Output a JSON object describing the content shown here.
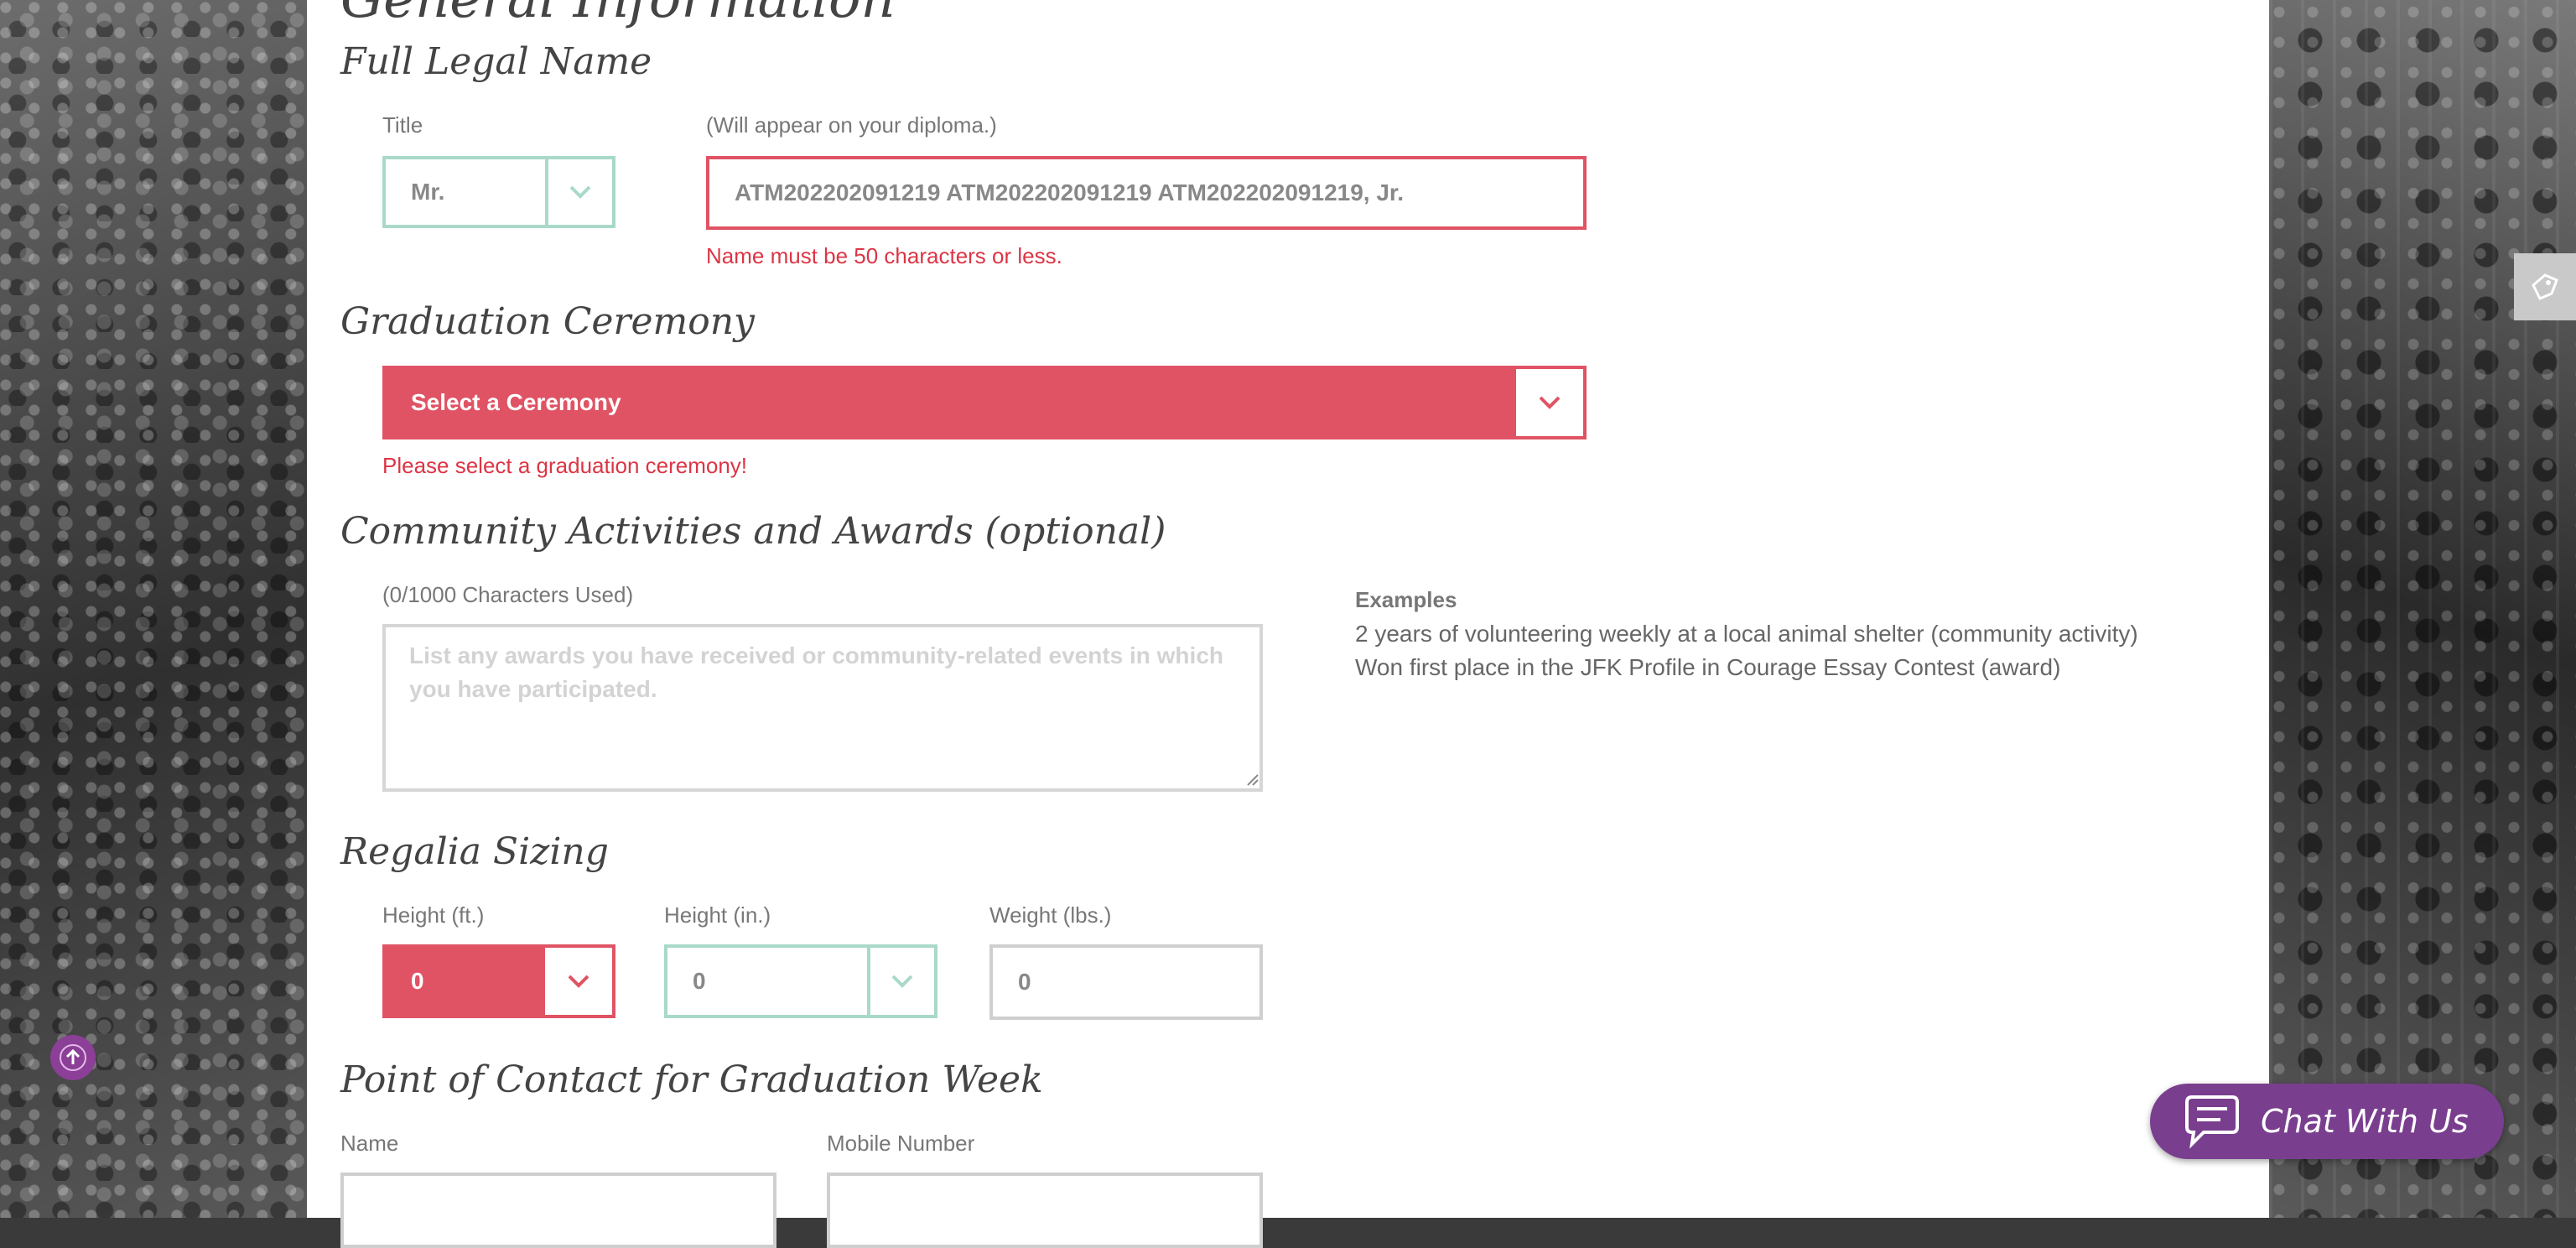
{
  "page": {
    "section_title": "General Information"
  },
  "legal_name": {
    "heading": "Full Legal Name",
    "title_label": "Title",
    "title_value": "Mr.",
    "name_label": "(Will appear on your diploma.)",
    "name_value": "ATM202202091219 ATM202202091219 ATM202202091219, Jr.",
    "error": "Name must be 50 characters or less."
  },
  "ceremony": {
    "heading": "Graduation Ceremony",
    "select_value": "Select a Ceremony",
    "error": "Please select a graduation ceremony!"
  },
  "activities": {
    "heading": "Community Activities and Awards (optional)",
    "counter": "(0/1000 Characters Used)",
    "placeholder": "List any awards you have received or community-related events in which you have participated.",
    "examples_label": "Examples",
    "examples": [
      "2 years of volunteering weekly at a local animal shelter   (community activity)",
      "Won first place in the JFK Profile in Courage Essay Contest   (award)"
    ]
  },
  "regalia": {
    "heading": "Regalia Sizing",
    "height_ft_label": "Height (ft.)",
    "height_ft_value": "0",
    "height_in_label": "Height (in.)",
    "height_in_value": "0",
    "weight_label": "Weight (lbs.)",
    "weight_value": "0"
  },
  "contact": {
    "heading": "Point of Contact for Graduation Week",
    "name_label": "Name",
    "mobile_label": "Mobile Number"
  },
  "chat": {
    "label": "Chat With Us"
  },
  "colors": {
    "error_red": "#e05364",
    "field_green": "#a9d9c8",
    "chat_purple": "#7a3e8f"
  }
}
